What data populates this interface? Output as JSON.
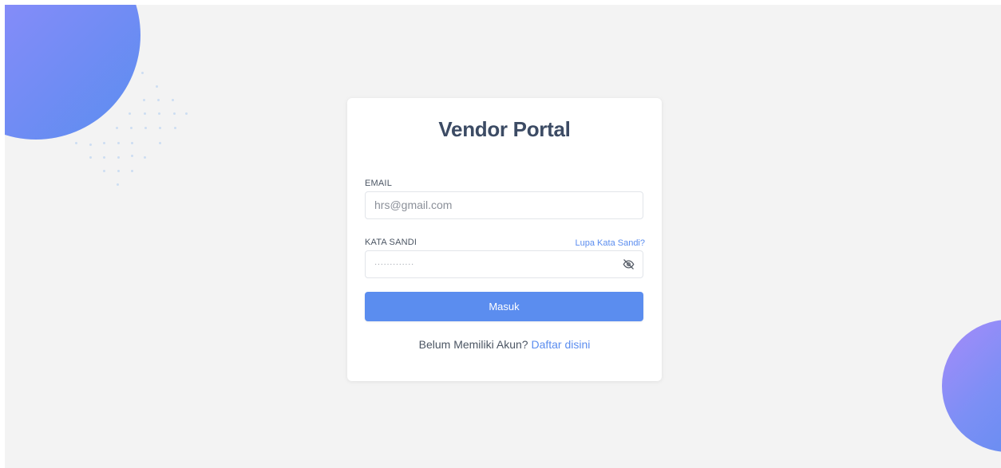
{
  "app": {
    "title": "Vendor Portal"
  },
  "login": {
    "email_label": "EMAIL",
    "email_value": "hrs@gmail.com",
    "password_label": "KATA SANDI",
    "forgot_link": "Lupa Kata Sandi?",
    "password_value": "·············",
    "submit_label": "Masuk",
    "register_prompt": "Belum Memiliki Akun?",
    "register_link": "Daftar disini"
  },
  "icons": {
    "password_toggle": "eye-off-icon"
  },
  "colors": {
    "accent": "#5b8def",
    "title": "#3c4b64",
    "background": "#f3f3f3",
    "blob_start": "#a78bfa",
    "blob_end": "#5b8def"
  }
}
